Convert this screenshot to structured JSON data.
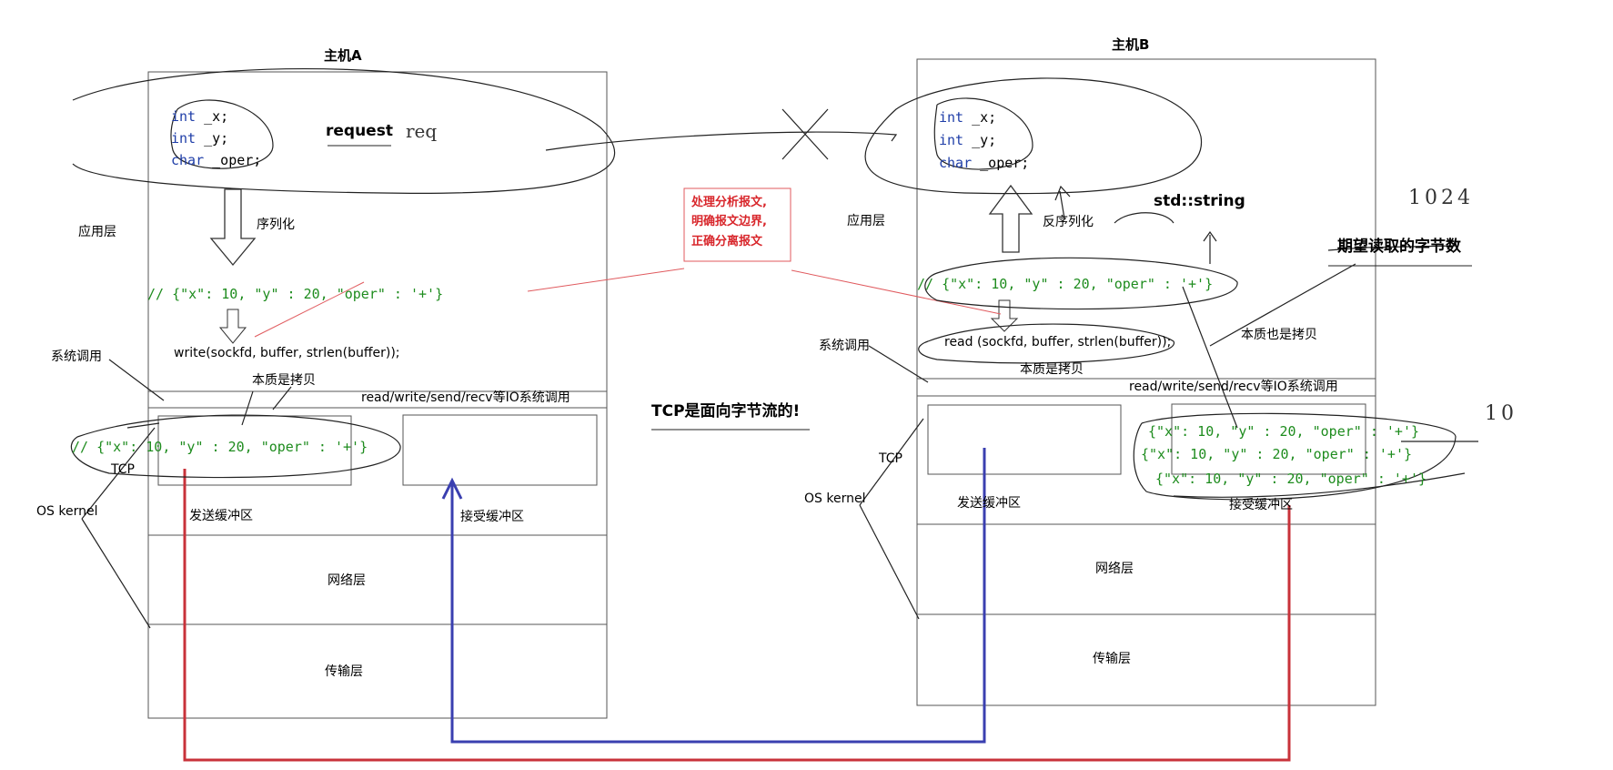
{
  "host_a": {
    "title": "主机A",
    "code_lines": [
      {
        "kw": "int",
        "rest": " _x;"
      },
      {
        "kw": "int",
        "rest": " _y;"
      },
      {
        "kw": "char",
        "rest": " _oper;"
      }
    ],
    "request_label": "request",
    "request_scribble": "req",
    "serialize_label": "序列化",
    "app_layer": "应用层",
    "json_line": "// {\"x\": 10, \"y\" : 20, \"oper\" : '+'}",
    "syscall_label": "系统调用",
    "write_call": "write(sockfd, buffer, strlen(buffer));",
    "copy_note": "本质是拷贝",
    "io_calls": "read/write/send/recv等IO系统调用",
    "buffer_json": "// {\"x\": 10, \"y\" : 20, \"oper\" : '+'}",
    "tcp_label": "TCP",
    "os_kernel": "OS kernel",
    "send_buffer": "发送缓冲区",
    "recv_buffer": "接受缓冲区",
    "network_layer": "网络层",
    "transport_layer": "传输层"
  },
  "host_b": {
    "title": "主机B",
    "code_lines": [
      {
        "kw": "int",
        "rest": " _x;"
      },
      {
        "kw": "int",
        "rest": " _y;"
      },
      {
        "kw": "char",
        "rest": " _oper;"
      }
    ],
    "deserialize_label": "反序列化",
    "std_string": "std::string",
    "app_layer": "应用层",
    "json_line": "// {\"x\": 10, \"y\" : 20, \"oper\" : '+'}",
    "syscall_label": "系统调用",
    "read_call": "read (sockfd, buffer, strlen(buffer));",
    "copy_note_1": "本质也是拷贝",
    "copy_note_2": "本质是拷贝",
    "io_calls": "read/write/send/recv等IO系统调用",
    "tcp_label": "TCP",
    "os_kernel": "OS kernel",
    "send_buffer": "发送缓冲区",
    "recv_buffer": "接受缓冲区",
    "recv_json": [
      "{\"x\": 10, \"y\" : 20, \"oper\" : '+'}",
      "{\"x\": 10, \"y\" : 20, \"oper\" : '+'}",
      "{\"x\": 10, \"y\" : 20, \"oper\" : '+'}"
    ],
    "network_layer": "网络层",
    "transport_layer": "传输层",
    "expected_bytes": "期望读取的字节数",
    "hw_1024": "1024",
    "hw_10": "10"
  },
  "center": {
    "note_lines": [
      "处理分析报文,",
      "明确报文边界,",
      "正确分离报文"
    ],
    "tcp_stream": "TCP是面向字节流的!"
  },
  "colors": {
    "keyword": "#1f3ea8",
    "json": "#1e8c1e",
    "note": "#d8262b",
    "send_line": "#c8323a",
    "recv_line": "#3a3fb0"
  }
}
